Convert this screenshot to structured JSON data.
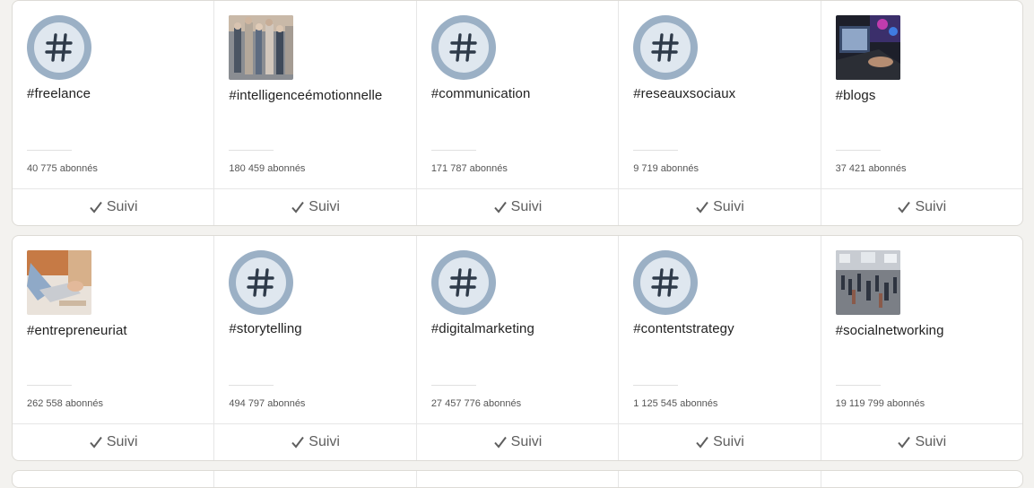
{
  "follow_label": "Suivi",
  "colors": {
    "hash_outer": "#9bb0c5",
    "hash_inner": "#dfe7ef",
    "hash_glyph": "#2f3b4a"
  },
  "rows": [
    {
      "tiles": [
        {
          "icon": "hashtag-icon",
          "tag": "#freelance",
          "followers": "40 775 abonnés"
        },
        {
          "icon": "crowd-photo",
          "tag": "#intelligenceémotionnelle",
          "followers": "180 459 abonnés"
        },
        {
          "icon": "hashtag-icon",
          "tag": "#communication",
          "followers": "171 787 abonnés"
        },
        {
          "icon": "hashtag-icon",
          "tag": "#reseauxsociaux",
          "followers": "9 719 abonnés"
        },
        {
          "icon": "laptop-photo",
          "tag": "#blogs",
          "followers": "37 421 abonnés"
        }
      ]
    },
    {
      "tiles": [
        {
          "icon": "desk-laptop-photo",
          "tag": "#entrepreneuriat",
          "followers": "262 558 abonnés"
        },
        {
          "icon": "hashtag-icon",
          "tag": "#storytelling",
          "followers": "494 797 abonnés"
        },
        {
          "icon": "hashtag-icon",
          "tag": "#digitalmarketing",
          "followers": "27 457 776 abonnés"
        },
        {
          "icon": "hashtag-icon",
          "tag": "#contentstrategy",
          "followers": "1 125 545 abonnés"
        },
        {
          "icon": "station-crowd-photo",
          "tag": "#socialnetworking",
          "followers": "19 119 799 abonnés"
        }
      ]
    }
  ]
}
